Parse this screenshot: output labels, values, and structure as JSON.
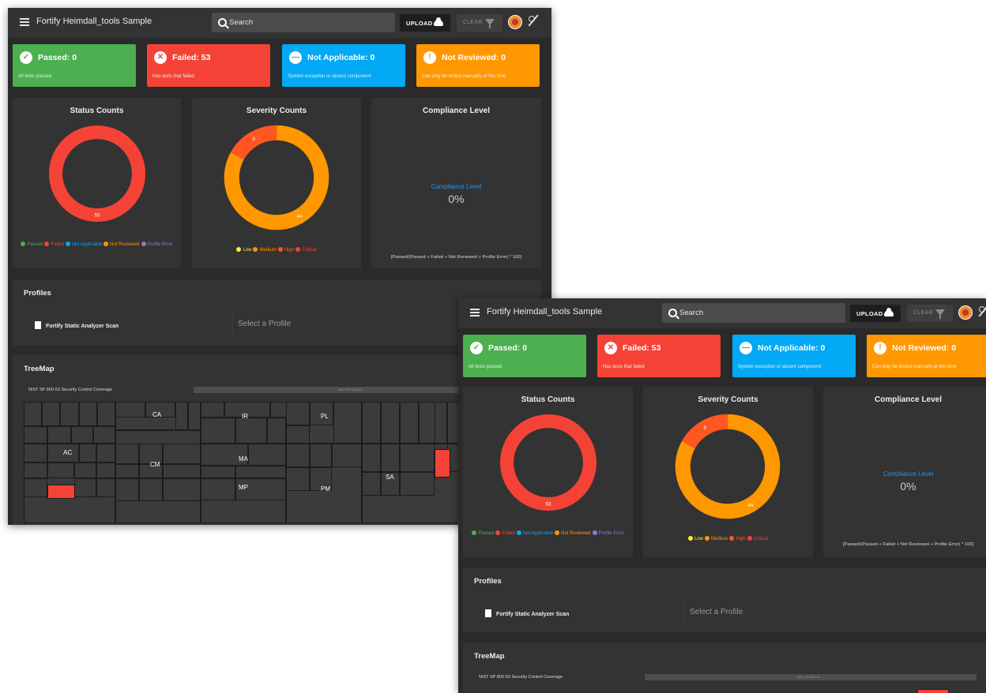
{
  "app": {
    "title": "Fortify Heimdall_tools Sample",
    "search_placeholder": "Search",
    "upload_label": "UPLOAD",
    "clear_label": "CLEAR"
  },
  "status": {
    "passed": {
      "title": "Passed: 0",
      "subtitle": "All tests passed",
      "color": "#4caf50"
    },
    "failed": {
      "title": "Failed: 53",
      "subtitle": "Has tests that failed",
      "color": "#f44336"
    },
    "not_applicable": {
      "title": "Not Applicable: 0",
      "subtitle": "System exception or absent component",
      "color": "#03a9f4"
    },
    "not_reviewed": {
      "title": "Not Reviewed: 0",
      "subtitle": "Can only be tested manually at this time",
      "color": "#ff9800"
    }
  },
  "panels": {
    "status_counts": {
      "title": "Status Counts"
    },
    "severity_counts": {
      "title": "Severity Counts"
    },
    "compliance": {
      "title": "Compliance Level",
      "label": "Compliance Level",
      "value": "0%",
      "formula": "[Passed/(Passed + Failed + Not Reviewed + Profile Error) * 100]"
    }
  },
  "legends": {
    "status": [
      {
        "label": "Passed",
        "color": "#4caf50"
      },
      {
        "label": "Failed",
        "color": "#f44336"
      },
      {
        "label": "Not Applicable",
        "color": "#03a9f4"
      },
      {
        "label": "Not Reviewed",
        "color": "#ff9800"
      },
      {
        "label": "Profile Error",
        "color": "#9575cd"
      }
    ],
    "severity": [
      {
        "label": "Low",
        "color": "#ffeb3b"
      },
      {
        "label": "Medium",
        "color": "#ff9800"
      },
      {
        "label": "High",
        "color": "#ff5722"
      },
      {
        "label": "Critical",
        "color": "#f44336"
      }
    ]
  },
  "chart_data": [
    {
      "type": "pie",
      "title": "Status Counts",
      "categories": [
        "Passed",
        "Failed",
        "Not Applicable",
        "Not Reviewed",
        "Profile Error"
      ],
      "values": [
        0,
        53,
        0,
        0,
        0
      ],
      "colors": [
        "#4caf50",
        "#f44336",
        "#03a9f4",
        "#ff9800",
        "#9575cd"
      ],
      "data_labels": [
        "",
        "53",
        "",
        "",
        ""
      ]
    },
    {
      "type": "pie",
      "title": "Severity Counts",
      "categories": [
        "Low",
        "Medium",
        "High",
        "Critical"
      ],
      "values": [
        0,
        44,
        9,
        0
      ],
      "colors": [
        "#ffeb3b",
        "#ff9800",
        "#ff5722",
        "#f44336"
      ],
      "data_labels": [
        "",
        "44",
        "9",
        ""
      ]
    }
  ],
  "profiles": {
    "title": "Profiles",
    "item": "Fortify Static Analyzer Scan",
    "select_placeholder": "Select a Profile"
  },
  "treemap": {
    "title": "TreeMap",
    "caption": "NIST SP 800-53 Security Control Coverage",
    "bar_label": "NIST SP 800-53 →",
    "families": [
      "CA",
      "IR",
      "PL",
      "AC",
      "CM",
      "MA",
      "MP",
      "PM",
      "SA"
    ]
  }
}
